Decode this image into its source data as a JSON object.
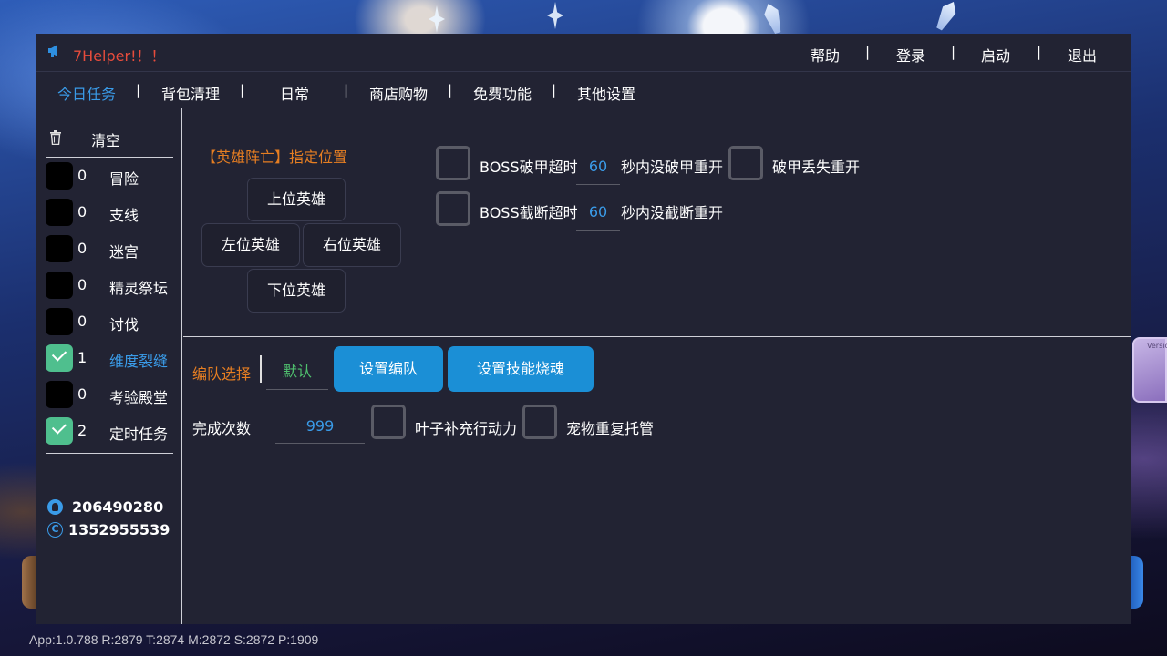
{
  "app": {
    "title": "7Helper!！！"
  },
  "top_menu": {
    "help": "帮助",
    "login": "登录",
    "start": "启动",
    "exit": "退出",
    "separator": "|"
  },
  "tabs": [
    {
      "label": "今日任务",
      "active": true
    },
    {
      "label": "背包清理",
      "active": false
    },
    {
      "label": "日常",
      "active": false
    },
    {
      "label": "商店购物",
      "active": false
    },
    {
      "label": "免费功能",
      "active": false
    },
    {
      "label": "其他设置",
      "active": false
    }
  ],
  "sidebar": {
    "clear_label": "清空",
    "tasks": [
      {
        "count": "0",
        "label": "冒险",
        "checked": false
      },
      {
        "count": "0",
        "label": "支线",
        "checked": false
      },
      {
        "count": "0",
        "label": "迷宫",
        "checked": false
      },
      {
        "count": "0",
        "label": "精灵祭坛",
        "checked": false
      },
      {
        "count": "0",
        "label": "讨伐",
        "checked": false
      },
      {
        "count": "1",
        "label": "维度裂缝",
        "checked": true,
        "active": true
      },
      {
        "count": "0",
        "label": "考验殿堂",
        "checked": false
      },
      {
        "count": "2",
        "label": "定时任务",
        "checked": true
      }
    ],
    "contacts": {
      "qq": "206490280",
      "copyright_id": "1352955539"
    }
  },
  "hero_panel": {
    "title": "【英雄阵亡】指定位置",
    "buttons": {
      "top": "上位英雄",
      "left": "左位英雄",
      "right": "右位英雄",
      "bottom": "下位英雄"
    }
  },
  "boss_panel": {
    "row1": {
      "label": "BOSS破甲超时",
      "value": "60",
      "suffix": "秒内没破甲重开",
      "extra_label": "破甲丢失重开"
    },
    "row2": {
      "label": "BOSS截断超时",
      "value": "60",
      "suffix": "秒内没截断重开"
    }
  },
  "team_panel": {
    "label": "编队选择",
    "default_value": "默认",
    "set_team_button": "设置编队",
    "set_skill_button": "设置技能烧魂",
    "count_label": "完成次数",
    "count_value": "999",
    "leaf_label": "叶子补充行动力",
    "pet_label": "宠物重复托管"
  },
  "version_thumb": {
    "label": "Version"
  },
  "status_bar": {
    "text": "App:1.0.788  R:2879 T:2874 M:2872 S:2872 P:1909"
  },
  "colors": {
    "panel_bg": "#222333",
    "accent_blue": "#3a9be8",
    "orange": "#e67e22",
    "red_title": "#e74c3c",
    "check_green": "#4fbf8e",
    "button_blue": "#1b8fd6"
  }
}
